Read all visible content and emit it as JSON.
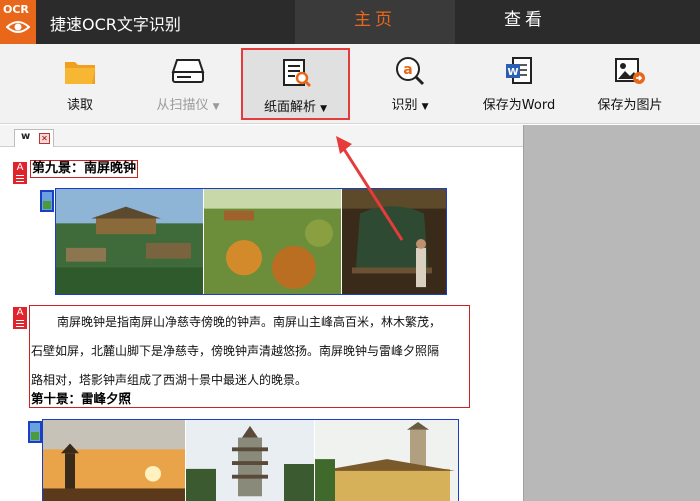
{
  "app": {
    "logo_text": "OCR",
    "title": "捷速OCR文字识别"
  },
  "main_tabs": [
    {
      "label": "主页",
      "active": true
    },
    {
      "label": "查看",
      "active": false
    }
  ],
  "toolbar": {
    "read": {
      "label": "读取",
      "icon": "folder-icon"
    },
    "scan": {
      "label": "从扫描仪",
      "icon": "scanner-icon",
      "disabled": true
    },
    "parse": {
      "label": "纸面解析",
      "icon": "document-search-icon",
      "highlighted": true
    },
    "recognize": {
      "label": "识别",
      "icon": "ocr-recognize-icon"
    },
    "save_word": {
      "label": "保存为Word",
      "icon": "word-icon"
    },
    "save_image": {
      "label": "保存为图片",
      "icon": "image-export-icon"
    }
  },
  "doc_tab": {
    "label": "w",
    "close_icon": "close-icon"
  },
  "document": {
    "heading9": "第九景：南屏晚钟",
    "paragraph_lines": [
      "南屏晚钟是指南屏山净慈寺傍晚的钟声。南屏山主峰高百米，林木繁茂，",
      "石壁如屏，北麓山脚下是净慈寺，傍晚钟声清越悠扬。南屏晚钟与雷峰夕照隔",
      "路相对，塔影钟声组成了西湖十景中最迷人的晚景。"
    ],
    "heading10": "第十景：雷峰夕照"
  },
  "colors": {
    "accent": "#e8671b",
    "titlebar": "#2b2b2b",
    "region_text_border": "#cc2222",
    "region_image_border": "#1a3fc4",
    "callout_arrow": "#e53b3b"
  }
}
